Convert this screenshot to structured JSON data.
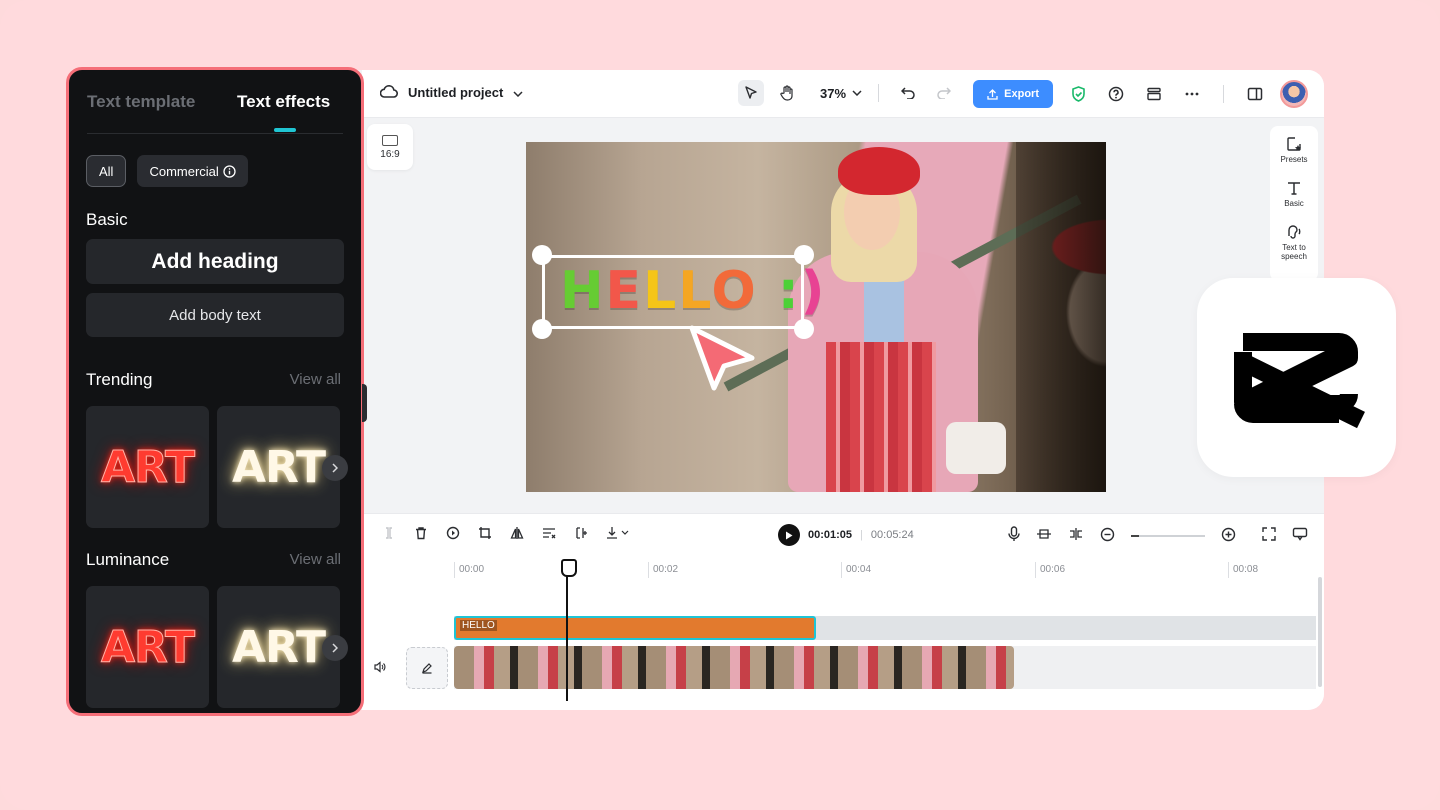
{
  "left_panel": {
    "tabs": [
      {
        "label": "Text template",
        "active": false
      },
      {
        "label": "Text effects",
        "active": true
      }
    ],
    "chips": [
      {
        "label": "All"
      },
      {
        "label": "Commercial"
      }
    ],
    "basic": {
      "title": "Basic",
      "heading_label": "Add heading",
      "body_label": "Add body text"
    },
    "trending": {
      "title": "Trending",
      "view_all": "View all",
      "cards": [
        "ART",
        "ART"
      ]
    },
    "luminance": {
      "title": "Luminance",
      "view_all": "View all",
      "cards": [
        "ART",
        "ART"
      ]
    }
  },
  "topbar": {
    "project_name": "Untitled project",
    "zoom": "37%",
    "export_label": "Export"
  },
  "canvas": {
    "aspect_ratio": "16:9",
    "overlay_text": [
      "H",
      "E",
      "L",
      "L",
      "O",
      " ",
      ":",
      ")"
    ],
    "overlay_colors": [
      "#66cc33",
      "#f2574a",
      "#f5c518",
      "#f5a623",
      "#f26a3a",
      "#ffffff",
      "#4cd137",
      "#e84393"
    ]
  },
  "right_panel": {
    "items": [
      {
        "label": "Presets",
        "icon": "presets-icon"
      },
      {
        "label": "Basic",
        "icon": "text-icon"
      },
      {
        "label": "Text to speech",
        "icon": "tts-icon"
      }
    ]
  },
  "timeline": {
    "current_time": "00:01:05",
    "total_time": "00:05:24",
    "ruler": [
      "00:00",
      "00:02",
      "00:04",
      "00:06",
      "00:08"
    ],
    "text_clip_label": "HELLO"
  },
  "colors": {
    "accent": "#3d8dff",
    "panel_border": "#f56e78",
    "tab_indicator": "#20c5d3",
    "text_clip": "#e27a2e",
    "text_clip_border": "#1ec5d6",
    "background": "#ffdadd"
  }
}
